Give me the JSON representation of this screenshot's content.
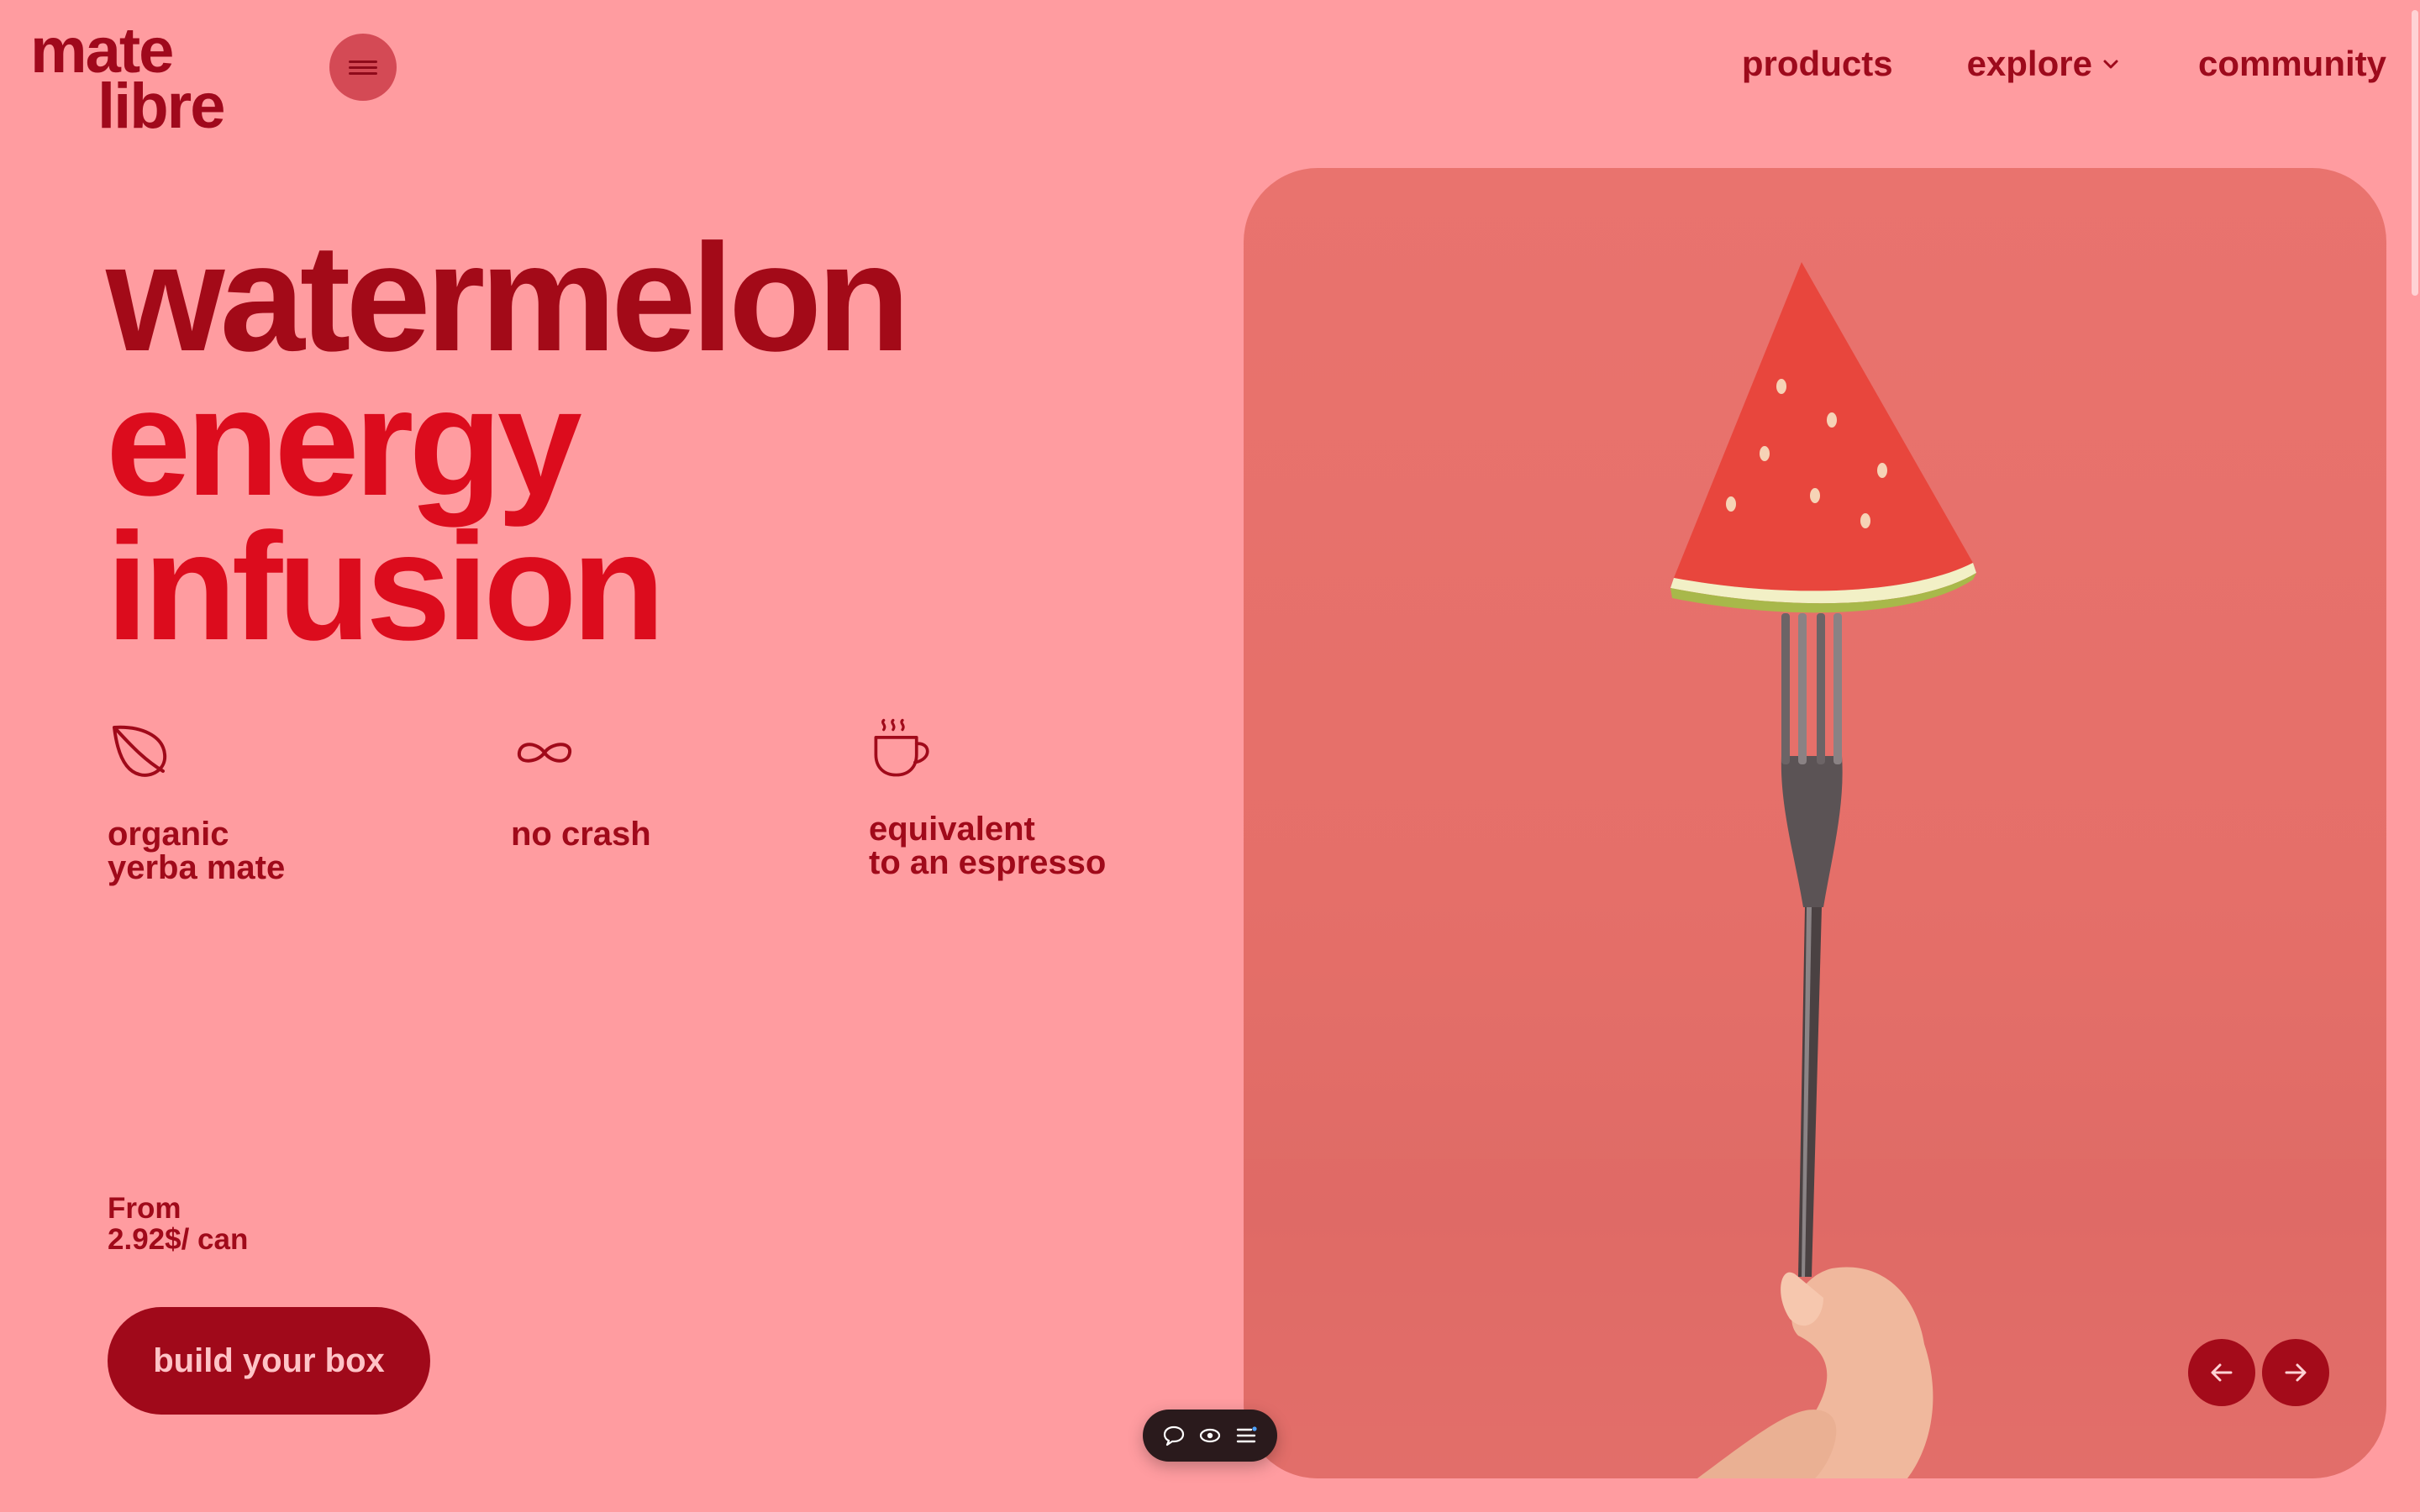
{
  "logo": {
    "line1": "mate",
    "line2": "libre"
  },
  "nav": {
    "products": "products",
    "explore": "explore",
    "community": "community"
  },
  "headline": {
    "line1": "watermelon",
    "line2": "energy",
    "line3": "infusion"
  },
  "features": [
    {
      "icon": "leaf-icon",
      "line1": "organic",
      "line2": "yerba mate"
    },
    {
      "icon": "infinity-icon",
      "line1": "no crash",
      "line2": ""
    },
    {
      "icon": "coffee-cup-icon",
      "line1": "equivalent",
      "line2": "to an espresso"
    }
  ],
  "price": {
    "line1": "From",
    "line2": "2.92$/ can"
  },
  "cta": {
    "label": "build your box"
  },
  "hero": {
    "subject": "watermelon-slice-on-fork-photo"
  },
  "colors": {
    "background": "#ff9ca0",
    "brand_dark": "#a0091a",
    "brand_bright": "#dc0c1d",
    "photo_bg": "#e8716c"
  }
}
